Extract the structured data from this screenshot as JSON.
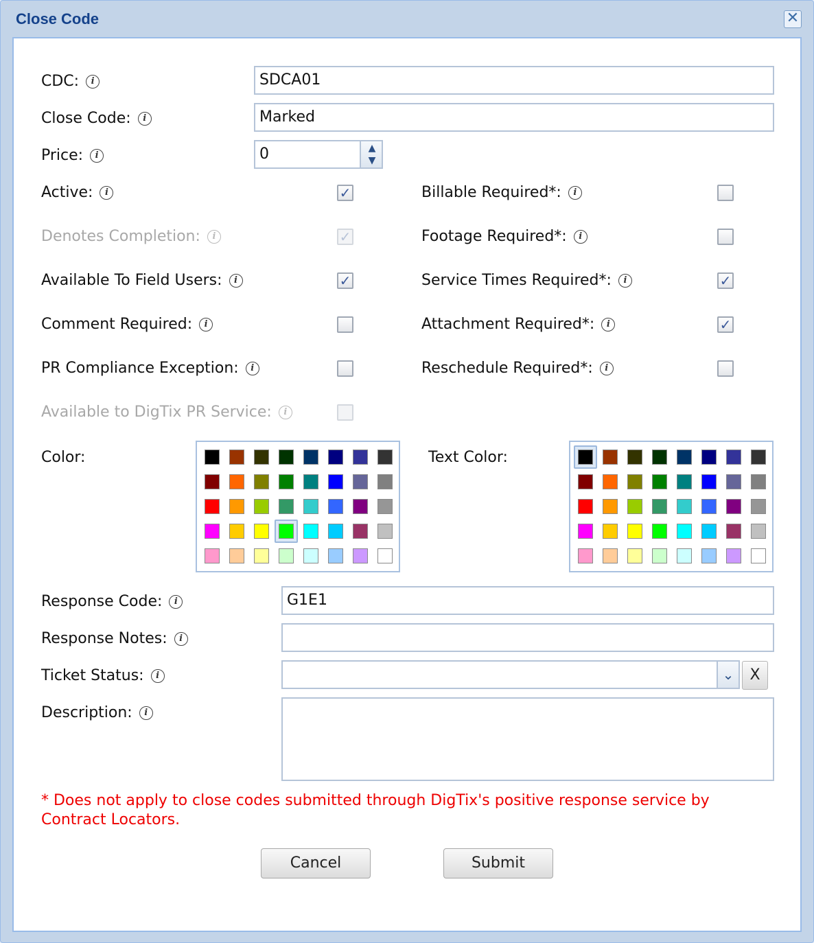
{
  "window": {
    "title": "Close Code",
    "close_icon": "close-icon"
  },
  "form": {
    "cdc": {
      "label": "CDC:",
      "value": "SDCA01"
    },
    "close_code": {
      "label": "Close Code:",
      "value": "Marked"
    },
    "price": {
      "label": "Price:",
      "value": "0"
    },
    "checkboxes_left": [
      {
        "label": "Active:",
        "checked": true,
        "disabled": false
      },
      {
        "label": "Denotes Completion:",
        "checked": true,
        "disabled": true
      },
      {
        "label": "Available To Field Users:",
        "checked": true,
        "disabled": false
      },
      {
        "label": "Comment Required:",
        "checked": false,
        "disabled": false
      },
      {
        "label": "PR Compliance Exception:",
        "checked": false,
        "disabled": false
      },
      {
        "label": "Available to DigTix PR Service:",
        "checked": false,
        "disabled": true
      }
    ],
    "checkboxes_right": [
      {
        "label": "Billable Required*:",
        "checked": false
      },
      {
        "label": "Footage Required*:",
        "checked": false
      },
      {
        "label": "Service Times Required*:",
        "checked": true
      },
      {
        "label": "Attachment Required*:",
        "checked": true
      },
      {
        "label": "Reschedule Required*:",
        "checked": false
      }
    ],
    "color": {
      "label": "Color:",
      "selected": "#00ff00"
    },
    "text_color": {
      "label": "Text Color:",
      "selected": "#000000"
    },
    "palette": [
      "#000000",
      "#993300",
      "#333300",
      "#003300",
      "#003366",
      "#000080",
      "#333399",
      "#333333",
      "#800000",
      "#ff6600",
      "#808000",
      "#008000",
      "#008080",
      "#0000ff",
      "#666699",
      "#808080",
      "#ff0000",
      "#ff9900",
      "#99cc00",
      "#339966",
      "#33cccc",
      "#3366ff",
      "#800080",
      "#969696",
      "#ff00ff",
      "#ffcc00",
      "#ffff00",
      "#00ff00",
      "#00ffff",
      "#00ccff",
      "#993366",
      "#c0c0c0",
      "#ff99cc",
      "#ffcc99",
      "#ffff99",
      "#ccffcc",
      "#ccffff",
      "#99ccff",
      "#cc99ff",
      "#ffffff"
    ],
    "response_code": {
      "label": "Response Code:",
      "value": "G1E1"
    },
    "response_notes": {
      "label": "Response Notes:",
      "value": ""
    },
    "ticket_status": {
      "label": "Ticket Status:",
      "value": "",
      "clear_label": "X"
    },
    "description": {
      "label": "Description:",
      "value": ""
    },
    "note": "* Does not apply to close codes submitted through DigTix's positive response service by Contract Locators."
  },
  "buttons": {
    "cancel": "Cancel",
    "submit": "Submit"
  },
  "icons": {
    "info": "info-icon",
    "spin_up": "chevron-up-icon",
    "spin_down": "chevron-down-icon",
    "dropdown": "chevron-down-icon"
  }
}
